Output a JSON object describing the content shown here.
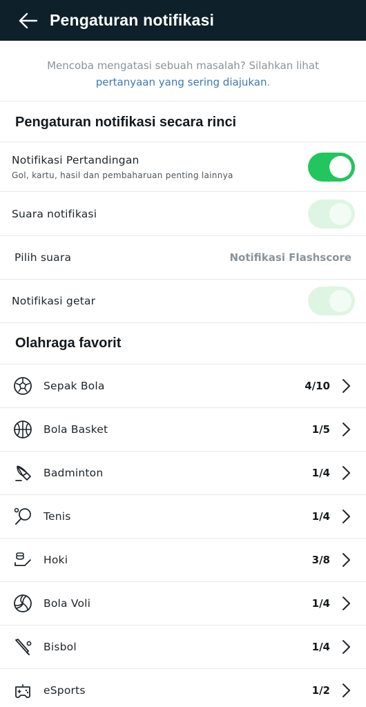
{
  "header": {
    "title": "Pengaturan notifikasi"
  },
  "help": {
    "text": "Mencoba mengatasi sebuah masalah? Silahkan lihat",
    "link": "pertanyaan yang sering diajukan",
    "suffix": "."
  },
  "detail_section": {
    "title": "Pengaturan notifikasi secara rinci",
    "match_notifications": {
      "label": "Notifikasi Pertandingan",
      "sub": "Gol, kartu, hasil dan pembaharuan penting lainnya",
      "state": "on"
    },
    "sound": {
      "label": "Suara notifikasi",
      "state": "on-disabled"
    },
    "choose_sound": {
      "label": "Pilih suara",
      "value": "Notifikasi Flashscore"
    },
    "vibrate": {
      "label": "Notifikasi getar",
      "state": "on-disabled"
    }
  },
  "favorites": {
    "title": "Olahraga favorit",
    "items": [
      {
        "name": "Sepak Bola",
        "count": "4/10",
        "icon": "soccer-ball-icon"
      },
      {
        "name": "Bola Basket",
        "count": "1/5",
        "icon": "basketball-icon"
      },
      {
        "name": "Badminton",
        "count": "1/4",
        "icon": "shuttlecock-icon"
      },
      {
        "name": "Tenis",
        "count": "1/4",
        "icon": "tennis-racket-icon"
      },
      {
        "name": "Hoki",
        "count": "3/8",
        "icon": "hockey-icon"
      },
      {
        "name": "Bola Voli",
        "count": "1/4",
        "icon": "volleyball-icon"
      },
      {
        "name": "Bisbol",
        "count": "1/4",
        "icon": "baseball-bat-icon"
      },
      {
        "name": "eSports",
        "count": "1/2",
        "icon": "gamepad-icon"
      }
    ]
  },
  "colors": {
    "app_bar": "#0e2029",
    "toggle_on": "#22c55e",
    "toggle_disabled": "#dff5e3",
    "link": "#3c78b6"
  }
}
